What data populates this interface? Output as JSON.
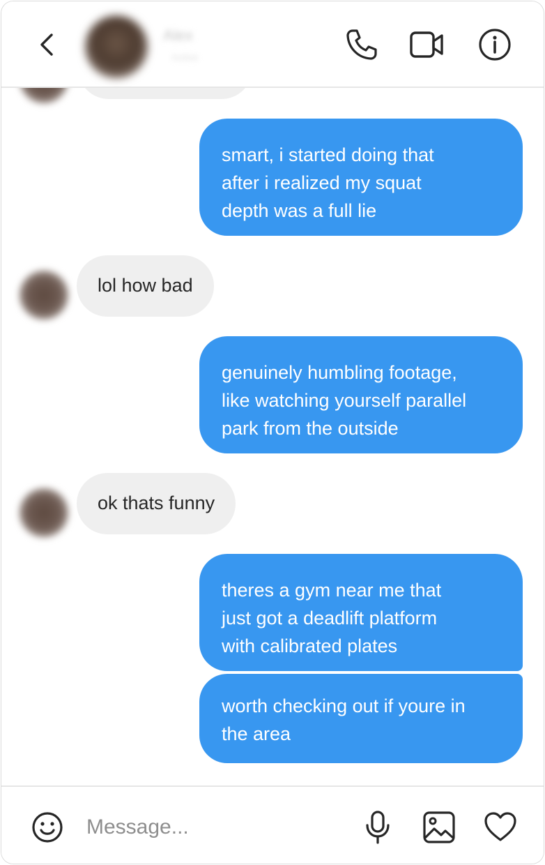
{
  "header": {
    "contact_name": "Alex",
    "contact_status": "Active"
  },
  "thread": {
    "messages": [
      {
        "from": "me",
        "text": "smart, i started doing that\nafter i realized my squat\ndepth was a full lie"
      },
      {
        "from": "them",
        "text": "lol how bad"
      },
      {
        "from": "me",
        "text": "genuinely humbling footage,\nlike watching yourself parallel\npark from the outside"
      },
      {
        "from": "them",
        "text": "ok thats funny"
      },
      {
        "from": "me",
        "text": "theres a gym near me that\njust got a deadlift platform\nwith calibrated plates"
      },
      {
        "from": "me",
        "text": "worth checking out if youre in\nthe area"
      }
    ]
  },
  "composer": {
    "placeholder": "Message..."
  },
  "colors": {
    "outgoing_bubble": "#3897f0",
    "incoming_bubble": "#efefef",
    "icon": "#262626"
  },
  "icons": [
    "chevron-left-icon",
    "phone-icon",
    "video-camera-icon",
    "info-icon",
    "emoji-icon",
    "microphone-icon",
    "image-icon",
    "heart-icon"
  ]
}
